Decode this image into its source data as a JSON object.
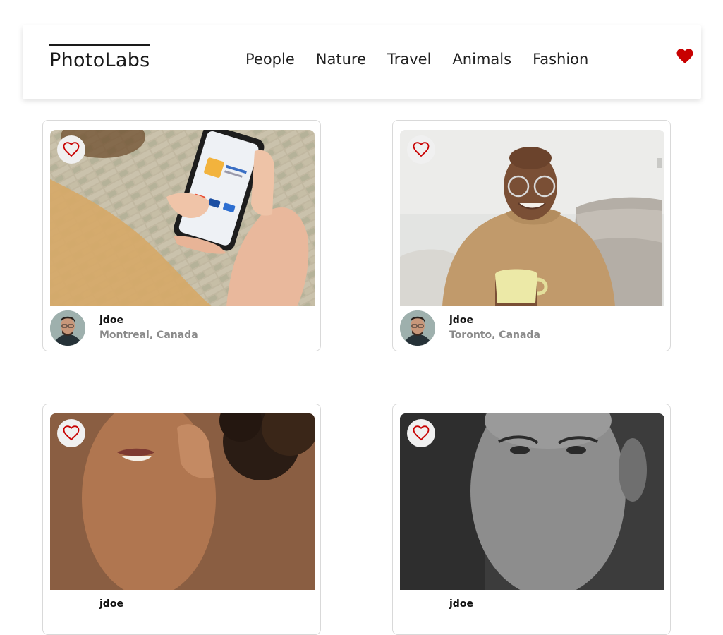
{
  "nav": {
    "logo": "PhotoLabs",
    "topics": [
      "People",
      "Nature",
      "Travel",
      "Animals",
      "Fashion"
    ],
    "fav_icon": "heart-filled-icon",
    "fav_color": "#c80000"
  },
  "photos": [
    {
      "username": "jdoe",
      "location": "Montreal, Canada",
      "favourited": false
    },
    {
      "username": "jdoe",
      "location": "Toronto, Canada",
      "favourited": false
    },
    {
      "username": "jdoe",
      "location": "",
      "favourited": false
    },
    {
      "username": "jdoe",
      "location": "",
      "favourited": false
    }
  ],
  "icons": {
    "like": "heart-outline-icon",
    "like_color": "#c80000"
  }
}
